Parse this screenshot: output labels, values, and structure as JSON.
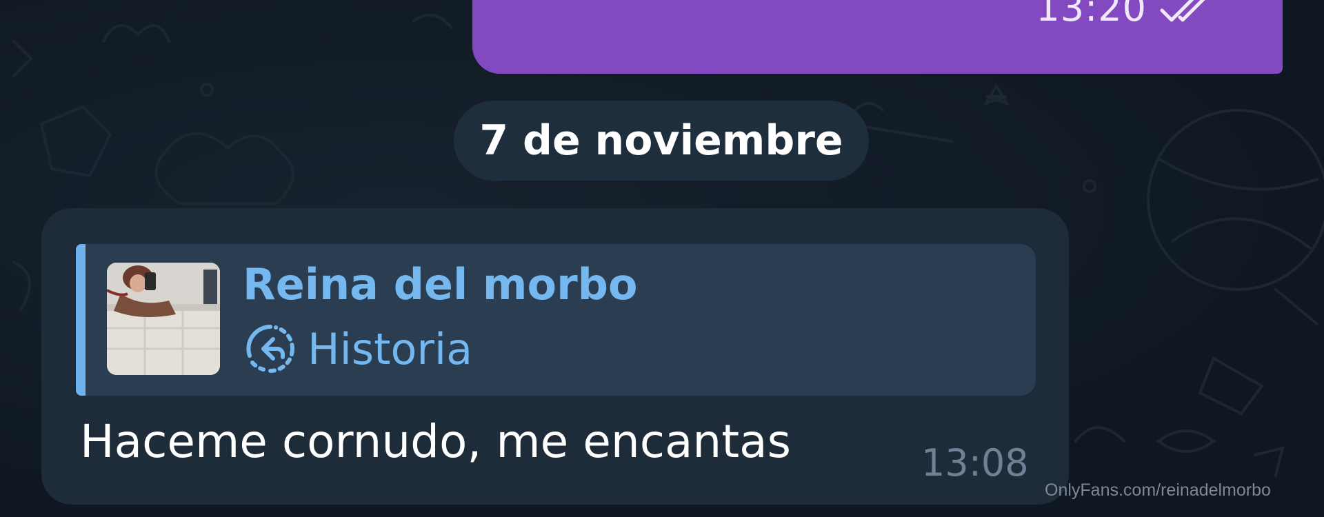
{
  "outgoing_message": {
    "time": "13:20",
    "status_icon": "double-check-icon"
  },
  "date_separator": "7 de noviembre",
  "incoming_message": {
    "reply": {
      "sender": "Reina del morbo",
      "kind": "Historia",
      "kind_icon": "story-reply-icon",
      "thumbnail": "story-thumbnail"
    },
    "text": "Haceme cornudo, me encantas",
    "time": "13:08"
  },
  "watermark": "OnlyFans.com/reinadelmorbo",
  "colors": {
    "background": "#0f1822",
    "outgoing_bubble": "#8349c0",
    "incoming_bubble": "#1e2b38",
    "reply_block": "#2b3d51",
    "accent_blue": "#75b7ef",
    "date_chip": "#1f2e3d"
  }
}
